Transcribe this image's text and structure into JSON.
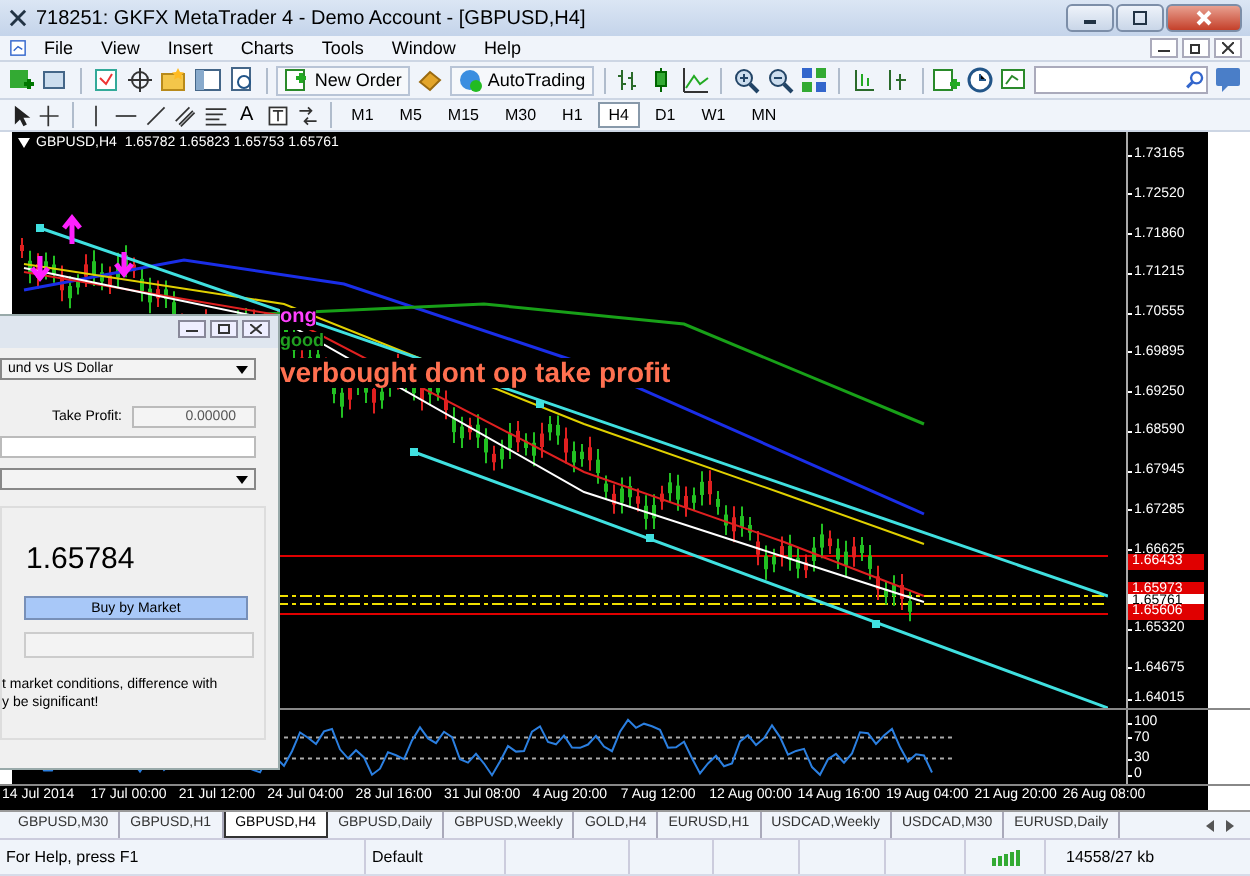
{
  "window": {
    "title": "718251: GKFX MetaTrader 4 - Demo Account - [GBPUSD,H4]"
  },
  "menu": [
    "File",
    "View",
    "Insert",
    "Charts",
    "Tools",
    "Window",
    "Help"
  ],
  "toolbar": {
    "new_order": "New Order",
    "autotrading": "AutoTrading",
    "text_tool": "A",
    "timeframes": [
      {
        "label": "M1",
        "selected": false
      },
      {
        "label": "M5",
        "selected": false
      },
      {
        "label": "M15",
        "selected": false
      },
      {
        "label": "M30",
        "selected": false
      },
      {
        "label": "H1",
        "selected": false
      },
      {
        "label": "H4",
        "selected": true
      },
      {
        "label": "D1",
        "selected": false
      },
      {
        "label": "W1",
        "selected": false
      },
      {
        "label": "MN",
        "selected": false
      }
    ]
  },
  "chart": {
    "header": "GBPUSD,H4  1.65782 1.65823 1.65753 1.65761",
    "notes": [
      {
        "text": "ong",
        "color": "#ff40ff"
      },
      {
        "text": "good",
        "color": "#20a020"
      },
      {
        "text": "verbought dont op take profit",
        "color": "#ff7050"
      }
    ],
    "price_labels": [
      "1.73165",
      "1.72520",
      "1.71860",
      "1.71215",
      "1.70555",
      "1.69895",
      "1.69250",
      "1.68590",
      "1.67945",
      "1.67285",
      "1.66625",
      "1.65320",
      "1.64675",
      "1.64015"
    ],
    "price_tags": [
      {
        "text": "1.66433",
        "kind": "alert"
      },
      {
        "text": "1.65973",
        "kind": "alert"
      },
      {
        "text": "1.65761",
        "kind": "bid"
      },
      {
        "text": "1.65606",
        "kind": "alert"
      }
    ],
    "indicator_labels": [
      "100",
      "70",
      "30",
      "0"
    ],
    "time_labels": [
      "14 Jul 2014",
      "17 Jul 00:00",
      "21 Jul 12:00",
      "24 Jul 04:00",
      "28 Jul 16:00",
      "31 Jul 08:00",
      "4 Aug 20:00",
      "7 Aug 12:00",
      "12 Aug 00:00",
      "14 Aug 16:00",
      "19 Aug 04:00",
      "21 Aug 20:00",
      "26 Aug 08:00"
    ]
  },
  "order_dialog": {
    "symbol": "und vs US Dollar",
    "take_profit_label": "Take Profit:",
    "take_profit": "0.00000",
    "price": "1.65784",
    "buy_button": "Buy by Market",
    "note": "t market conditions, difference with\ny be significant!"
  },
  "tabs": [
    {
      "label": "GBPUSD,M30",
      "selected": false
    },
    {
      "label": "GBPUSD,H1",
      "selected": false
    },
    {
      "label": "GBPUSD,H4",
      "selected": true
    },
    {
      "label": "GBPUSD,Daily",
      "selected": false
    },
    {
      "label": "GBPUSD,Weekly",
      "selected": false
    },
    {
      "label": "GOLD,H4",
      "selected": false
    },
    {
      "label": "EURUSD,H1",
      "selected": false
    },
    {
      "label": "USDCAD,Weekly",
      "selected": false
    },
    {
      "label": "USDCAD,M30",
      "selected": false
    },
    {
      "label": "EURUSD,Daily",
      "selected": false
    }
  ],
  "status_bar": {
    "help": "For Help, press F1",
    "profile": "Default",
    "traffic": "14558/27 kb"
  }
}
